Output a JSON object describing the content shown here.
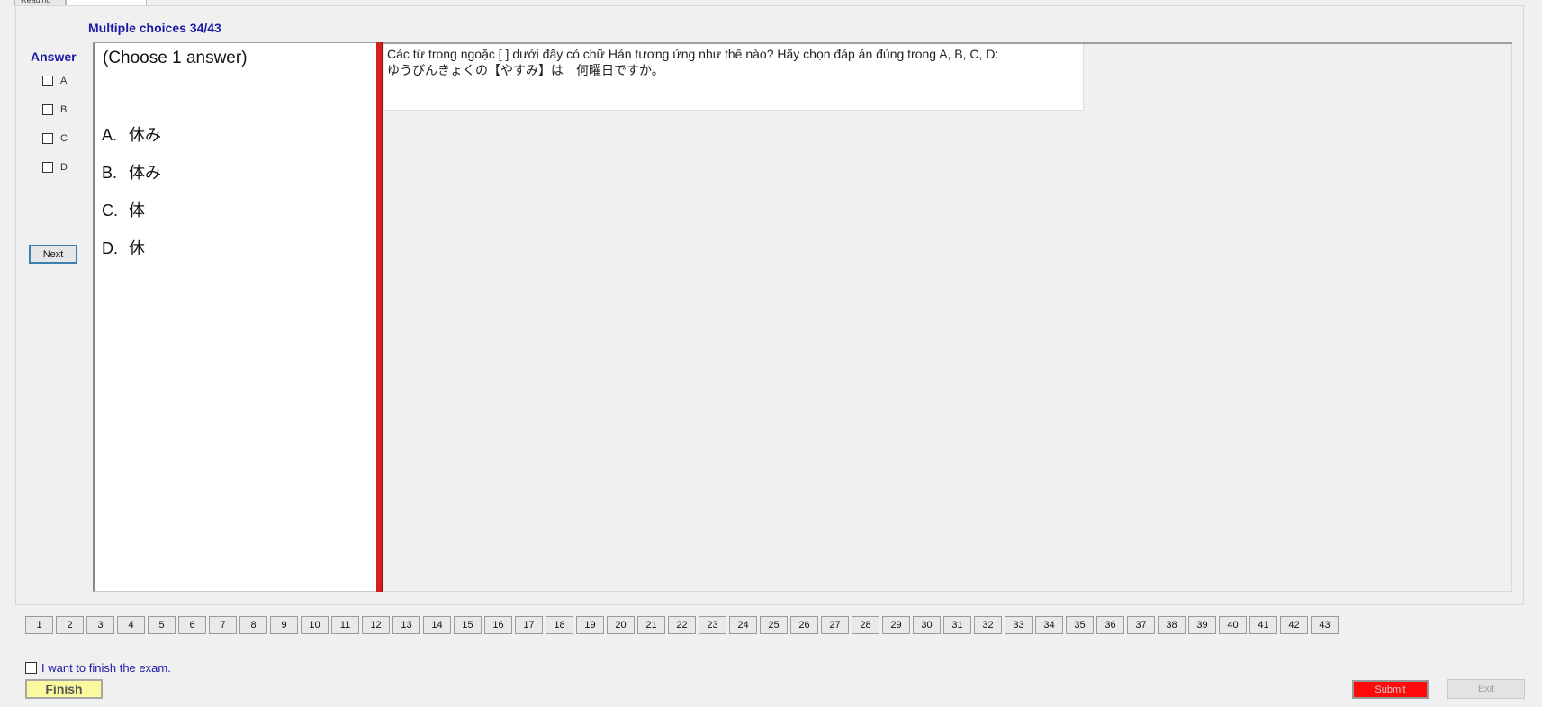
{
  "tabs": [
    "Reading",
    ""
  ],
  "section_title": "Multiple choices 34/43",
  "answer_panel": {
    "label": "Answer",
    "options": [
      "A",
      "B",
      "C",
      "D"
    ],
    "next_label": "Next"
  },
  "choice_panel": {
    "hint": "(Choose 1 answer)",
    "options": [
      {
        "letter": "A.",
        "text": "休み"
      },
      {
        "letter": "B.",
        "text": "体み"
      },
      {
        "letter": "C.",
        "text": "体"
      },
      {
        "letter": "D.",
        "text": "休"
      }
    ]
  },
  "question": {
    "line1": "Các từ trong ngoặc [    ]  dưới đây có chữ Hán tương ứng như thế nào? Hãy chọn đáp án đúng trong A, B, C, D:",
    "line2": "ゆうびんきょくの【やすみ】は　何曜日ですか。"
  },
  "question_numbers": [
    "1",
    "2",
    "3",
    "4",
    "5",
    "6",
    "7",
    "8",
    "9",
    "10",
    "11",
    "12",
    "13",
    "14",
    "15",
    "16",
    "17",
    "18",
    "19",
    "20",
    "21",
    "22",
    "23",
    "24",
    "25",
    "26",
    "27",
    "28",
    "29",
    "30",
    "31",
    "32",
    "33",
    "34",
    "35",
    "36",
    "37",
    "38",
    "39",
    "40",
    "41",
    "42",
    "43"
  ],
  "footer": {
    "finish_check_label": "I want to finish the exam.",
    "finish_label": "Finish",
    "submit_label": "Submit",
    "exit_label": "Exit"
  },
  "colors": {
    "accent_blue": "#1a1aa6",
    "divider_red": "#d42020",
    "finish_yellow": "#fbf9a0",
    "submit_red": "#ff0a0a"
  }
}
